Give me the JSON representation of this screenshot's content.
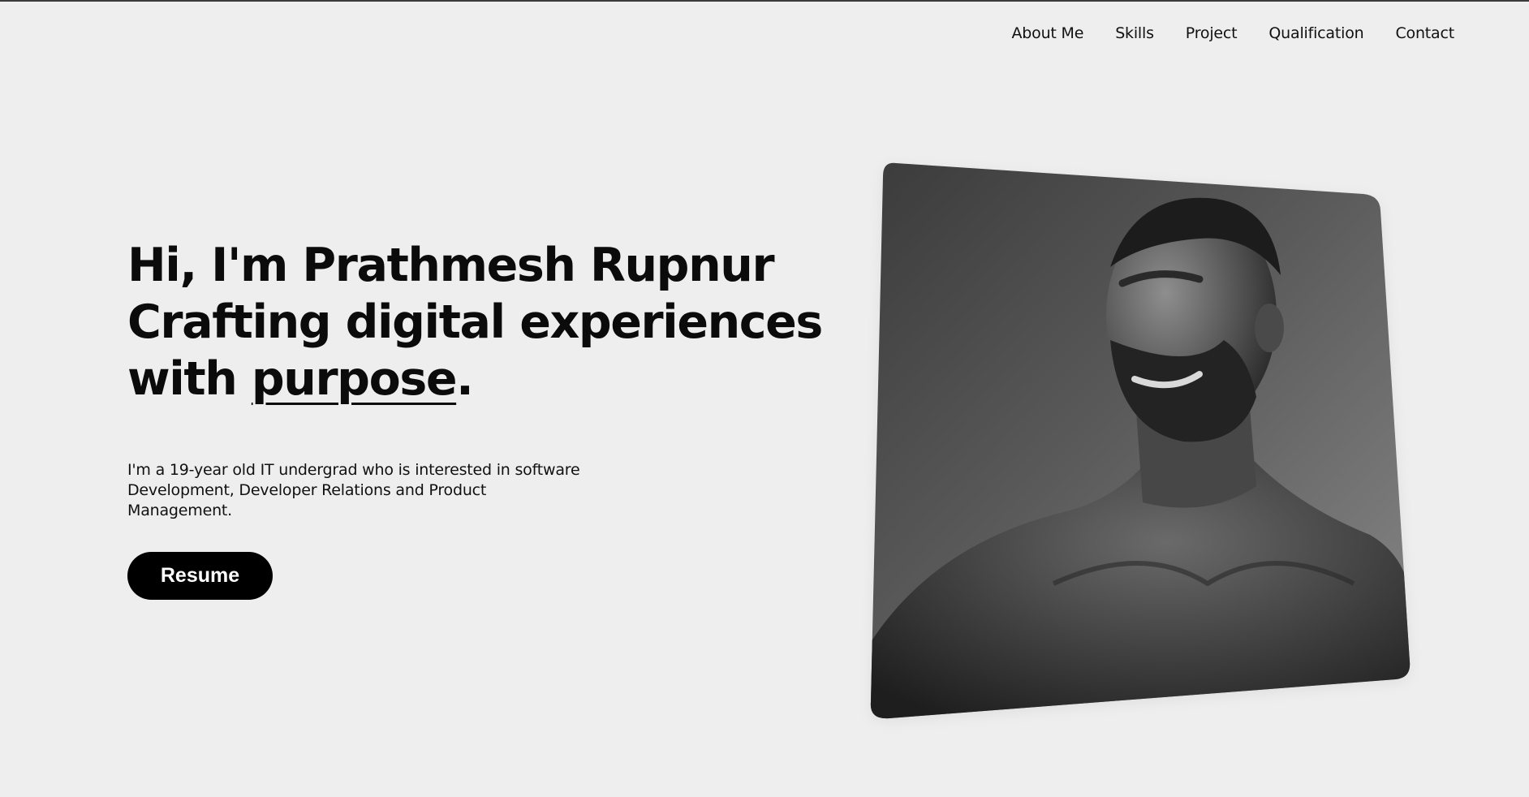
{
  "nav": {
    "items": [
      {
        "label": "About Me"
      },
      {
        "label": "Skills"
      },
      {
        "label": "Project"
      },
      {
        "label": "Qualification"
      },
      {
        "label": "Contact"
      }
    ]
  },
  "hero": {
    "line1": "Hi, I'm Prathmesh Rupnur",
    "line2": "Crafting digital experiences",
    "line3_start": "with ",
    "line3_emphasis": "purpose",
    "line3_end": ".",
    "intro": "I'm a 19-year old IT undergrad who is interested in software Development, Developer Relations and Product Management.",
    "resume_label": "Resume"
  },
  "colors": {
    "background": "#eeeeee",
    "text": "#0b0b0b",
    "button_bg": "#000000",
    "button_text": "#ffffff"
  }
}
